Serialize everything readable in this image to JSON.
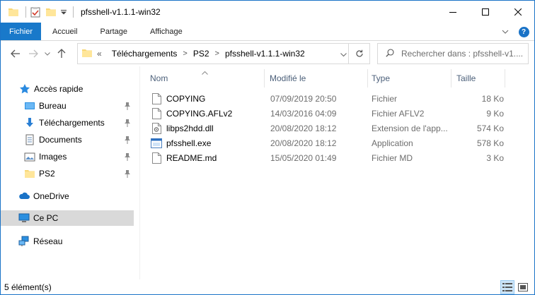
{
  "window": {
    "title": "pfsshell-v1.1.1-win32"
  },
  "ribbon": {
    "tabs": [
      "Fichier",
      "Accueil",
      "Partage",
      "Affichage"
    ]
  },
  "address": {
    "overflow": "«",
    "crumbs": [
      "Téléchargements",
      "PS2",
      "pfsshell-v1.1.1-win32"
    ]
  },
  "search": {
    "placeholder": "Rechercher dans : pfsshell-v1...."
  },
  "sidebar": {
    "items": [
      {
        "label": "Accès rapide",
        "icon": "star-icon",
        "pinned": false
      },
      {
        "label": "Bureau",
        "icon": "desktop-folder-icon",
        "pinned": true
      },
      {
        "label": "Téléchargements",
        "icon": "download-arrow-icon",
        "pinned": true
      },
      {
        "label": "Documents",
        "icon": "documents-icon",
        "pinned": true
      },
      {
        "label": "Images",
        "icon": "pictures-icon",
        "pinned": true
      },
      {
        "label": "PS2",
        "icon": "folder-icon",
        "pinned": true
      },
      {
        "label": "OneDrive",
        "icon": "cloud-icon",
        "pinned": false
      },
      {
        "label": "Ce PC",
        "icon": "computer-icon",
        "pinned": false
      },
      {
        "label": "Réseau",
        "icon": "network-icon",
        "pinned": false
      }
    ]
  },
  "columns": {
    "name": "Nom",
    "modified": "Modifié le",
    "type": "Type",
    "size": "Taille"
  },
  "files": [
    {
      "name": "COPYING",
      "modified": "07/09/2019 20:50",
      "type": "Fichier",
      "size": "18 Ko",
      "icon": "blank-file-icon"
    },
    {
      "name": "COPYING.AFLv2",
      "modified": "14/03/2016 04:09",
      "type": "Fichier AFLV2",
      "size": "9 Ko",
      "icon": "blank-file-icon"
    },
    {
      "name": "libps2hdd.dll",
      "modified": "20/08/2020 18:12",
      "type": "Extension de l'app...",
      "size": "574 Ko",
      "icon": "dll-file-icon"
    },
    {
      "name": "pfsshell.exe",
      "modified": "20/08/2020 18:12",
      "type": "Application",
      "size": "578 Ko",
      "icon": "exe-file-icon"
    },
    {
      "name": "README.md",
      "modified": "15/05/2020 01:49",
      "type": "Fichier MD",
      "size": "3 Ko",
      "icon": "blank-file-icon"
    }
  ],
  "status": {
    "count": "5 élément(s)"
  },
  "colors": {
    "accent": "#1979ca",
    "header_text": "#4c607a",
    "selected_bg": "#d9d9d9",
    "meta_text": "#6d6d6d"
  }
}
